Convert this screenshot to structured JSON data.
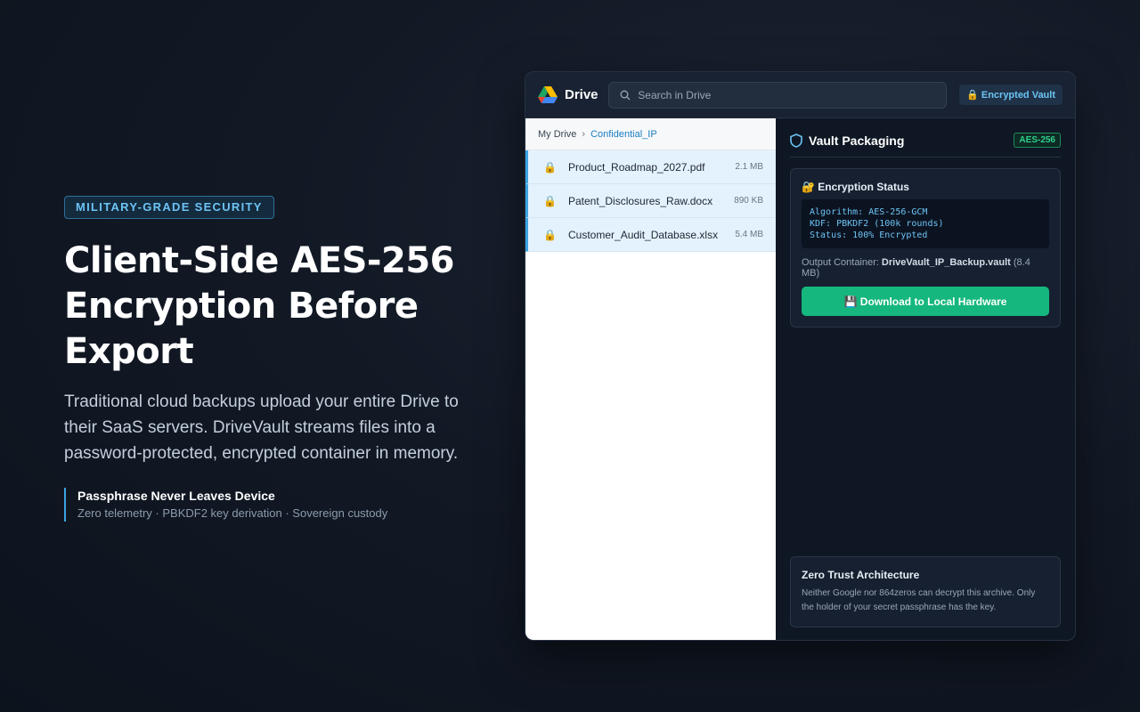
{
  "hero": {
    "badge": "MILITARY-GRADE SECURITY",
    "headline": "Client-Side AES-256 Encryption Before Export",
    "lede": "Traditional cloud backups upload your entire Drive to their SaaS servers. DriveVault streams files into a password-protected, encrypted container in memory.",
    "feature_title": "Passphrase Never Leaves Device",
    "feature_sub": "Zero telemetry · PBKDF2 key derivation · Sovereign custody"
  },
  "app": {
    "brand": "Drive",
    "search_placeholder": "Search in Drive",
    "vault_pill": "🔒 Encrypted Vault",
    "breadcrumb": {
      "root": "My Drive",
      "separator": "›",
      "current": "Confidential_IP"
    },
    "files": [
      {
        "name": "Product_Roadmap_2027.pdf",
        "size": "2.1 MB"
      },
      {
        "name": "Patent_Disclosures_Raw.docx",
        "size": "890 KB"
      },
      {
        "name": "Customer_Audit_Database.xlsx",
        "size": "5.4 MB"
      }
    ],
    "panel": {
      "title": "Vault Packaging",
      "tag": "AES-256",
      "status_title": "🔐 Encryption Status",
      "code_lines": [
        "Algorithm: AES-256-GCM",
        "KDF: PBKDF2 (100k rounds)",
        "Status: 100% Encrypted"
      ],
      "output_label": "Output Container:",
      "output_file": "DriveVault_IP_Backup.vault",
      "output_size": "(8.4 MB)",
      "download_label": "💾 Download to Local Hardware",
      "zt_title": "Zero Trust Architecture",
      "zt_text": "Neither Google nor 864zeros can decrypt this archive. Only the holder of your secret passphrase has the key."
    }
  },
  "colors": {
    "accent": "#3da3e0",
    "success": "#15b77e",
    "background": "#121925"
  }
}
